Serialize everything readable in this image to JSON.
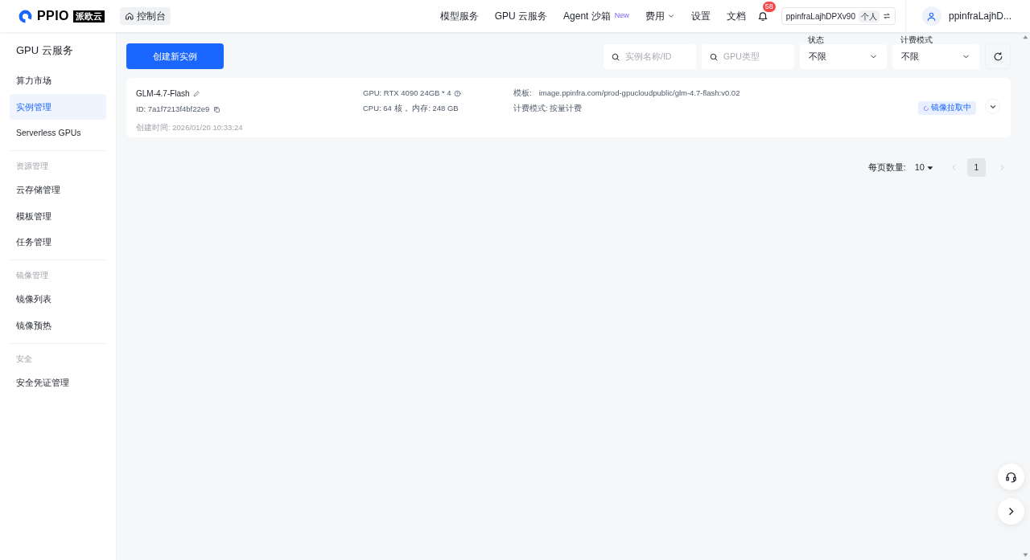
{
  "header": {
    "logo_text": "PPIO",
    "logo_badge": "派欧云",
    "console_button": "控制台",
    "nav": [
      {
        "label": "模型服务",
        "kind": "plain"
      },
      {
        "label": "GPU 云服务",
        "kind": "plain"
      },
      {
        "label": "Agent 沙箱",
        "kind": "badge",
        "badge": "New"
      },
      {
        "label": "费用",
        "kind": "dropdown"
      },
      {
        "label": "设置",
        "kind": "plain"
      },
      {
        "label": "文档",
        "kind": "plain"
      }
    ],
    "notification_count": "58",
    "account": "ppinfraLajhDPXv90",
    "account_type": "个人",
    "user_name": "ppinfraLajhD..."
  },
  "sidebar": {
    "title": "GPU 云服务",
    "sections": [
      {
        "items": [
          {
            "label": "算力市场",
            "selected": false
          },
          {
            "label": "实例管理",
            "selected": true
          },
          {
            "label": "Serverless GPUs",
            "selected": false
          }
        ]
      },
      {
        "heading": "资源管理",
        "items": [
          {
            "label": "云存储管理",
            "selected": false
          },
          {
            "label": "模板管理",
            "selected": false
          },
          {
            "label": "任务管理",
            "selected": false
          }
        ]
      },
      {
        "heading": "镜像管理",
        "items": [
          {
            "label": "镜像列表",
            "selected": false
          },
          {
            "label": "镜像预热",
            "selected": false
          }
        ]
      },
      {
        "heading": "安全",
        "items": [
          {
            "label": "安全凭证管理",
            "selected": false
          }
        ]
      }
    ]
  },
  "toolbar": {
    "create_button": "创建新实例",
    "searches": [
      {
        "placeholder": "实例名称/ID"
      },
      {
        "placeholder": "GPU类型"
      }
    ],
    "selects": [
      {
        "label": "状态",
        "value": "不限"
      },
      {
        "label": "计费模式",
        "value": "不限"
      }
    ]
  },
  "instances": [
    {
      "name": "GLM-4.7-Flash",
      "id": "ID: 7a1f7213f4bf22e9",
      "created": "创建时间: 2026/01/20 10:33:24",
      "gpu": "GPU: RTX 4090 24GB * 4",
      "cpu_memory": "CPU: 64 核， 内存: 248 GB",
      "template_label": "模板:",
      "template": "image.ppinfra.com/prod-gpucloudpublic/glm-4.7-flash:v0.02",
      "billing": "计费模式: 按量计费",
      "status": "镜像拉取中"
    }
  ],
  "pagination": {
    "page_size_label": "每页数量:",
    "page_size": "10",
    "pages": [
      {
        "label": "1",
        "selected": true
      }
    ]
  }
}
